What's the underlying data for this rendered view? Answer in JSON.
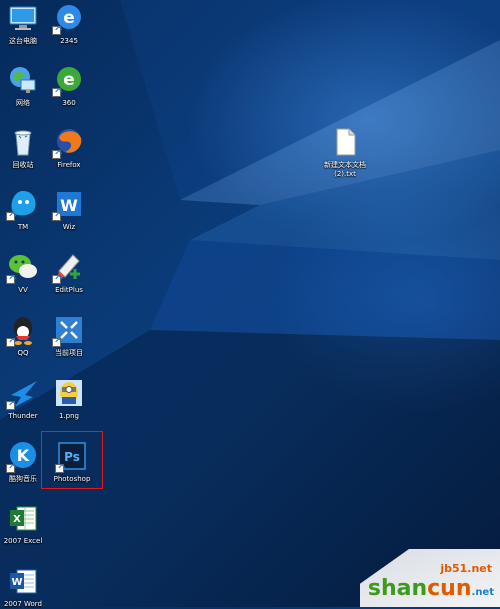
{
  "desktop": {
    "icons": [
      {
        "label": "这台电脑",
        "icon": "this-pc-icon"
      },
      {
        "label": "2345",
        "icon": "browser-2345-icon"
      },
      {
        "label": "网络",
        "icon": "network-icon"
      },
      {
        "label": "360",
        "icon": "browser-360-icon"
      },
      {
        "label": "回收站",
        "icon": "recycle-bin-icon"
      },
      {
        "label": "Firefox",
        "icon": "firefox-icon"
      },
      {
        "label": "TM",
        "icon": "tm-icon"
      },
      {
        "label": "Wiz",
        "icon": "wiz-icon"
      },
      {
        "label": "VV",
        "icon": "wechat-icon"
      },
      {
        "label": "EditPlus",
        "icon": "editplus-icon"
      },
      {
        "label": "QQ",
        "icon": "qq-icon"
      },
      {
        "label": "当前项目",
        "icon": "project-icon"
      },
      {
        "label": "Thunder",
        "icon": "thunder-icon"
      },
      {
        "label": "1.png",
        "icon": "png-image-icon"
      },
      {
        "label": "酷狗音乐",
        "icon": "kugou-icon"
      },
      {
        "label": "Photoshop",
        "icon": "photoshop-icon"
      },
      {
        "label": "2007 Excel",
        "icon": "excel-icon"
      },
      {
        "label": "2007 Word",
        "icon": "word-icon"
      },
      {
        "label": "新建文本文档\n(2).txt",
        "icon": "text-file-icon"
      }
    ]
  },
  "watermark": {
    "site": "jb51.net",
    "brand_a": "shan",
    "brand_b": "cun",
    "brand_c": ".net"
  },
  "colors": {
    "selection_border": "#e01818",
    "desktop_blue": "#0a3b78"
  }
}
